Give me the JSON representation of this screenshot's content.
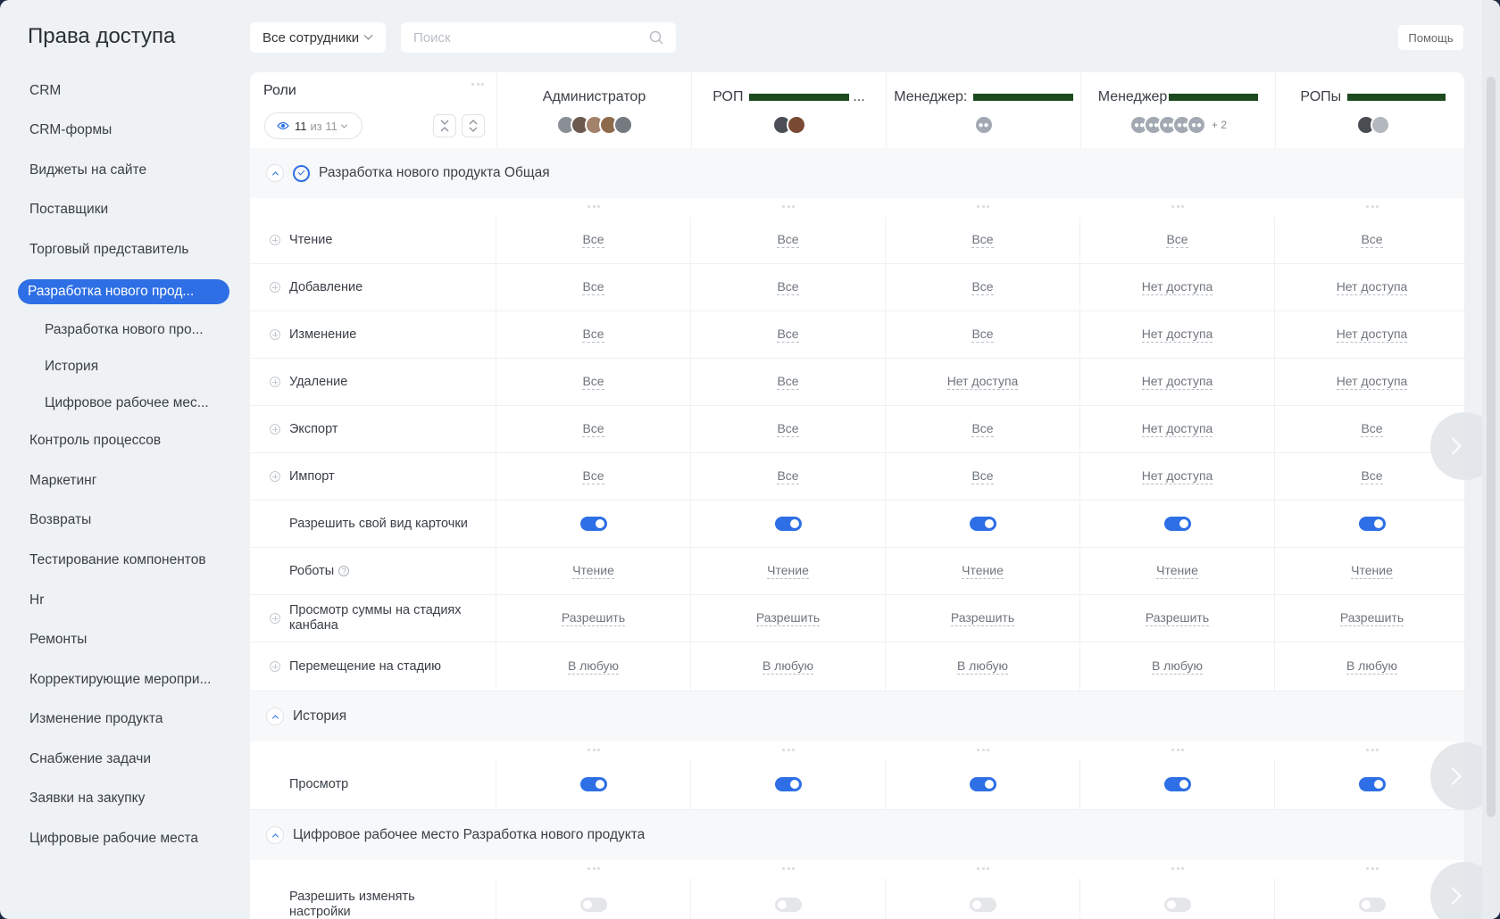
{
  "page": {
    "title": "Права доступа"
  },
  "toolbar": {
    "filter_value": "Все сотрудники",
    "search_placeholder": "Поиск",
    "help_label": "Помощь"
  },
  "sidebar": {
    "items": [
      {
        "label": "CRM"
      },
      {
        "label": "CRM-формы"
      },
      {
        "label": "Виджеты на сайте"
      },
      {
        "label": "Поставщики"
      },
      {
        "label": "Торговый представитель"
      },
      {
        "label": "Разработка нового прод..."
      },
      {
        "label": "Разработка нового про..."
      },
      {
        "label": "История"
      },
      {
        "label": "Цифровое рабочее мес..."
      },
      {
        "label": "Контроль процессов"
      },
      {
        "label": "Маркетинг"
      },
      {
        "label": "Возвраты"
      },
      {
        "label": "Тестирование компонентов"
      },
      {
        "label": "Hr"
      },
      {
        "label": "Ремонты"
      },
      {
        "label": "Корректирующие меропри..."
      },
      {
        "label": "Изменение продукта"
      },
      {
        "label": "Снабжение задачи"
      },
      {
        "label": "Заявки на закупку"
      },
      {
        "label": "Цифровые рабочие места"
      }
    ]
  },
  "roles": {
    "label": "Роли",
    "count": "11",
    "of_text": "из 11",
    "columns": [
      {
        "title": "Администратор"
      },
      {
        "title": "РОП",
        "suffix": "..."
      },
      {
        "title": "Менеджер:"
      },
      {
        "title": "Менеджер"
      },
      {
        "title": "РОПы"
      }
    ],
    "plus_more": "+ 2"
  },
  "sections": [
    {
      "title": "Разработка нового продукта Общая"
    },
    {
      "title": "История"
    },
    {
      "title": "Цифровое рабочее место Разработка нового продукта"
    }
  ],
  "rows": [
    {
      "label": "Чтение",
      "values": [
        "Все",
        "Все",
        "Все",
        "Все",
        "Все"
      ]
    },
    {
      "label": "Добавление",
      "values": [
        "Все",
        "Все",
        "Все",
        "Нет доступа",
        "Нет доступа"
      ]
    },
    {
      "label": "Изменение",
      "values": [
        "Все",
        "Все",
        "Все",
        "Нет доступа",
        "Нет доступа"
      ]
    },
    {
      "label": "Удаление",
      "values": [
        "Все",
        "Все",
        "Нет доступа",
        "Нет доступа",
        "Нет доступа"
      ]
    },
    {
      "label": "Экспорт",
      "values": [
        "Все",
        "Все",
        "Все",
        "Нет доступа",
        "Все"
      ]
    },
    {
      "label": "Импорт",
      "values": [
        "Все",
        "Все",
        "Все",
        "Нет доступа",
        "Все"
      ]
    },
    {
      "label": "Разрешить свой вид карточки",
      "toggles": [
        true,
        true,
        true,
        true,
        true
      ]
    },
    {
      "label": "Роботы",
      "values": [
        "Чтение",
        "Чтение",
        "Чтение",
        "Чтение",
        "Чтение"
      ]
    },
    {
      "label": "Просмотр суммы на стадиях канбана",
      "values": [
        "Разрешить",
        "Разрешить",
        "Разрешить",
        "Разрешить",
        "Разрешить"
      ]
    },
    {
      "label": "Перемещение на стадию",
      "values": [
        "В любую",
        "В любую",
        "В любую",
        "В любую",
        "В любую"
      ]
    },
    {
      "label": "Просмотр",
      "toggles": [
        true,
        true,
        true,
        true,
        true
      ]
    },
    {
      "label": "Разрешить изменять настройки",
      "toggles": [
        false,
        false,
        false,
        false,
        false
      ]
    }
  ],
  "colors": {
    "accent": "#2e6fe5",
    "background": "#eef2f4",
    "redaction": "#1d4a1e"
  }
}
